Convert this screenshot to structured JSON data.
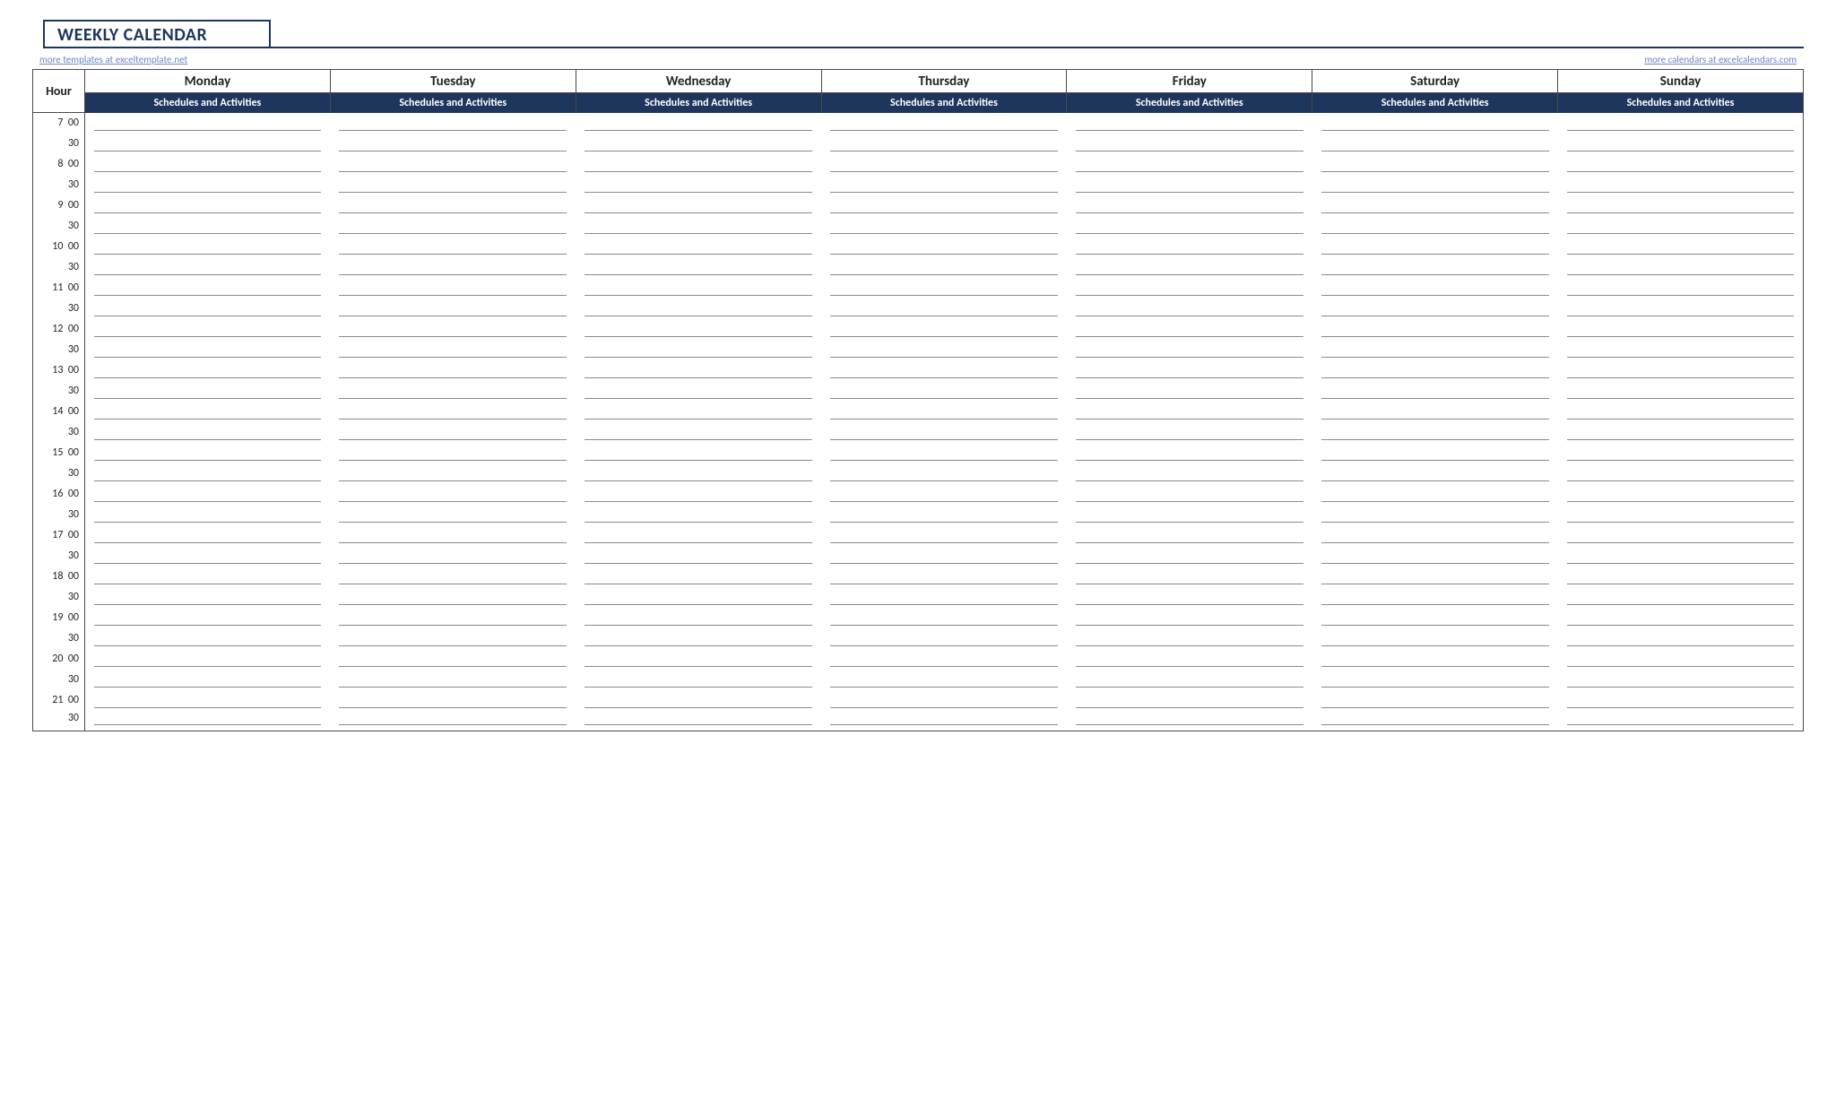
{
  "title": "WEEKLY CALENDAR",
  "links": {
    "left": "more templates at exceltemplate.net",
    "right": "more calendars at excelcalendars.com"
  },
  "header": {
    "hour_label": "Hour",
    "days": [
      "Monday",
      "Tuesday",
      "Wednesday",
      "Thursday",
      "Friday",
      "Saturday",
      "Sunday"
    ],
    "sub_label": "Schedules and Activities"
  },
  "time_rows": [
    {
      "hour": "7",
      "min": "00"
    },
    {
      "hour": "",
      "min": "30"
    },
    {
      "hour": "8",
      "min": "00"
    },
    {
      "hour": "",
      "min": "30"
    },
    {
      "hour": "9",
      "min": "00"
    },
    {
      "hour": "",
      "min": "30"
    },
    {
      "hour": "10",
      "min": "00"
    },
    {
      "hour": "",
      "min": "30"
    },
    {
      "hour": "11",
      "min": "00"
    },
    {
      "hour": "",
      "min": "30"
    },
    {
      "hour": "12",
      "min": "00"
    },
    {
      "hour": "",
      "min": "30"
    },
    {
      "hour": "13",
      "min": "00"
    },
    {
      "hour": "",
      "min": "30"
    },
    {
      "hour": "14",
      "min": "00"
    },
    {
      "hour": "",
      "min": "30"
    },
    {
      "hour": "15",
      "min": "00"
    },
    {
      "hour": "",
      "min": "30"
    },
    {
      "hour": "16",
      "min": "00"
    },
    {
      "hour": "",
      "min": "30"
    },
    {
      "hour": "17",
      "min": "00"
    },
    {
      "hour": "",
      "min": "30"
    },
    {
      "hour": "18",
      "min": "00"
    },
    {
      "hour": "",
      "min": "30"
    },
    {
      "hour": "19",
      "min": "00"
    },
    {
      "hour": "",
      "min": "30"
    },
    {
      "hour": "20",
      "min": "00"
    },
    {
      "hour": "",
      "min": "30"
    },
    {
      "hour": "21",
      "min": "00"
    },
    {
      "hour": "",
      "min": "30"
    }
  ]
}
